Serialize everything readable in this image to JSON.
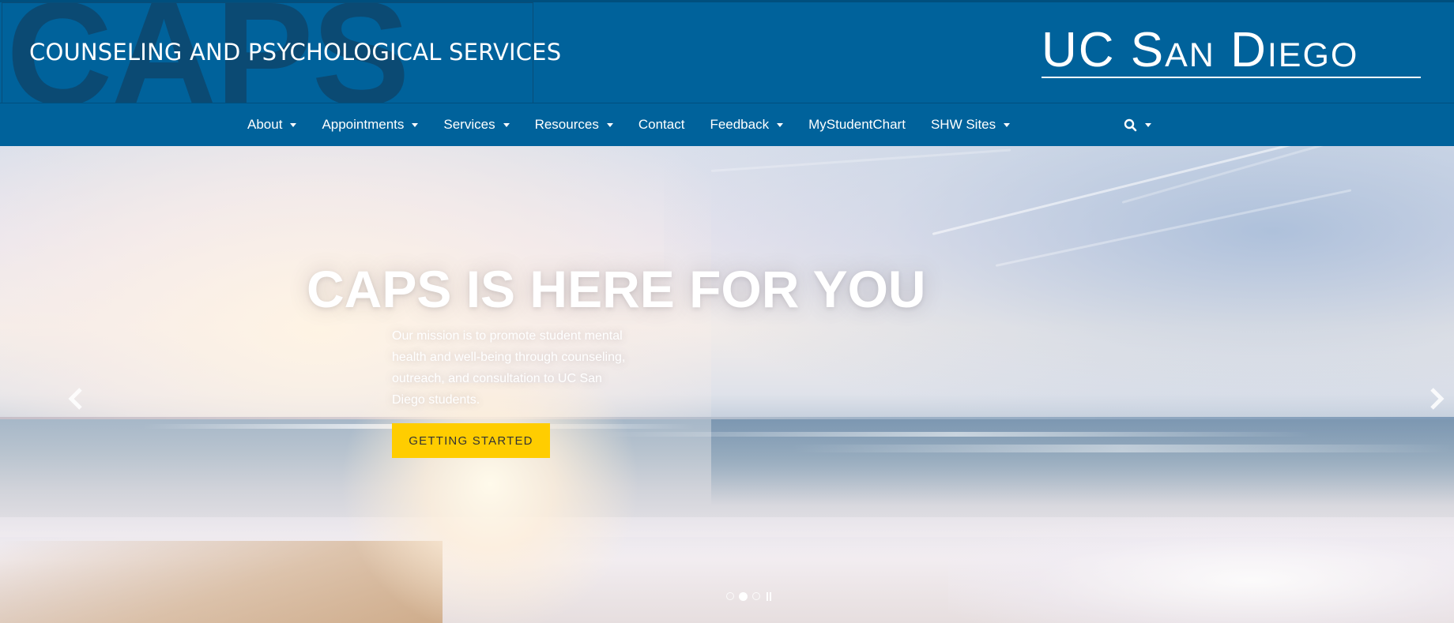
{
  "header": {
    "watermark": "CAPS",
    "site_title": "COUNSELING AND PSYCHOLOGICAL SERVICES",
    "logo_text": "UC San Diego"
  },
  "nav": {
    "items": [
      {
        "label": "About",
        "dropdown": true
      },
      {
        "label": "Appointments",
        "dropdown": true
      },
      {
        "label": "Services",
        "dropdown": true
      },
      {
        "label": "Resources",
        "dropdown": true
      },
      {
        "label": "Contact",
        "dropdown": false
      },
      {
        "label": "Feedback",
        "dropdown": true
      },
      {
        "label": "MyStudentChart",
        "dropdown": false
      },
      {
        "label": "SHW Sites",
        "dropdown": true
      }
    ],
    "search_icon": "search-icon"
  },
  "hero": {
    "heading": "CAPS IS HERE FOR YOU",
    "mission": "Our mission is to promote student mental health and well-being through counseling, outreach, and consultation to UC San Diego students.",
    "cta_label": "GETTING STARTED",
    "slides_count": 3,
    "active_slide": 2
  },
  "colors": {
    "brand_blue": "#00629b",
    "dark_blue": "#004f7e",
    "cta_gold": "#ffcd00"
  }
}
